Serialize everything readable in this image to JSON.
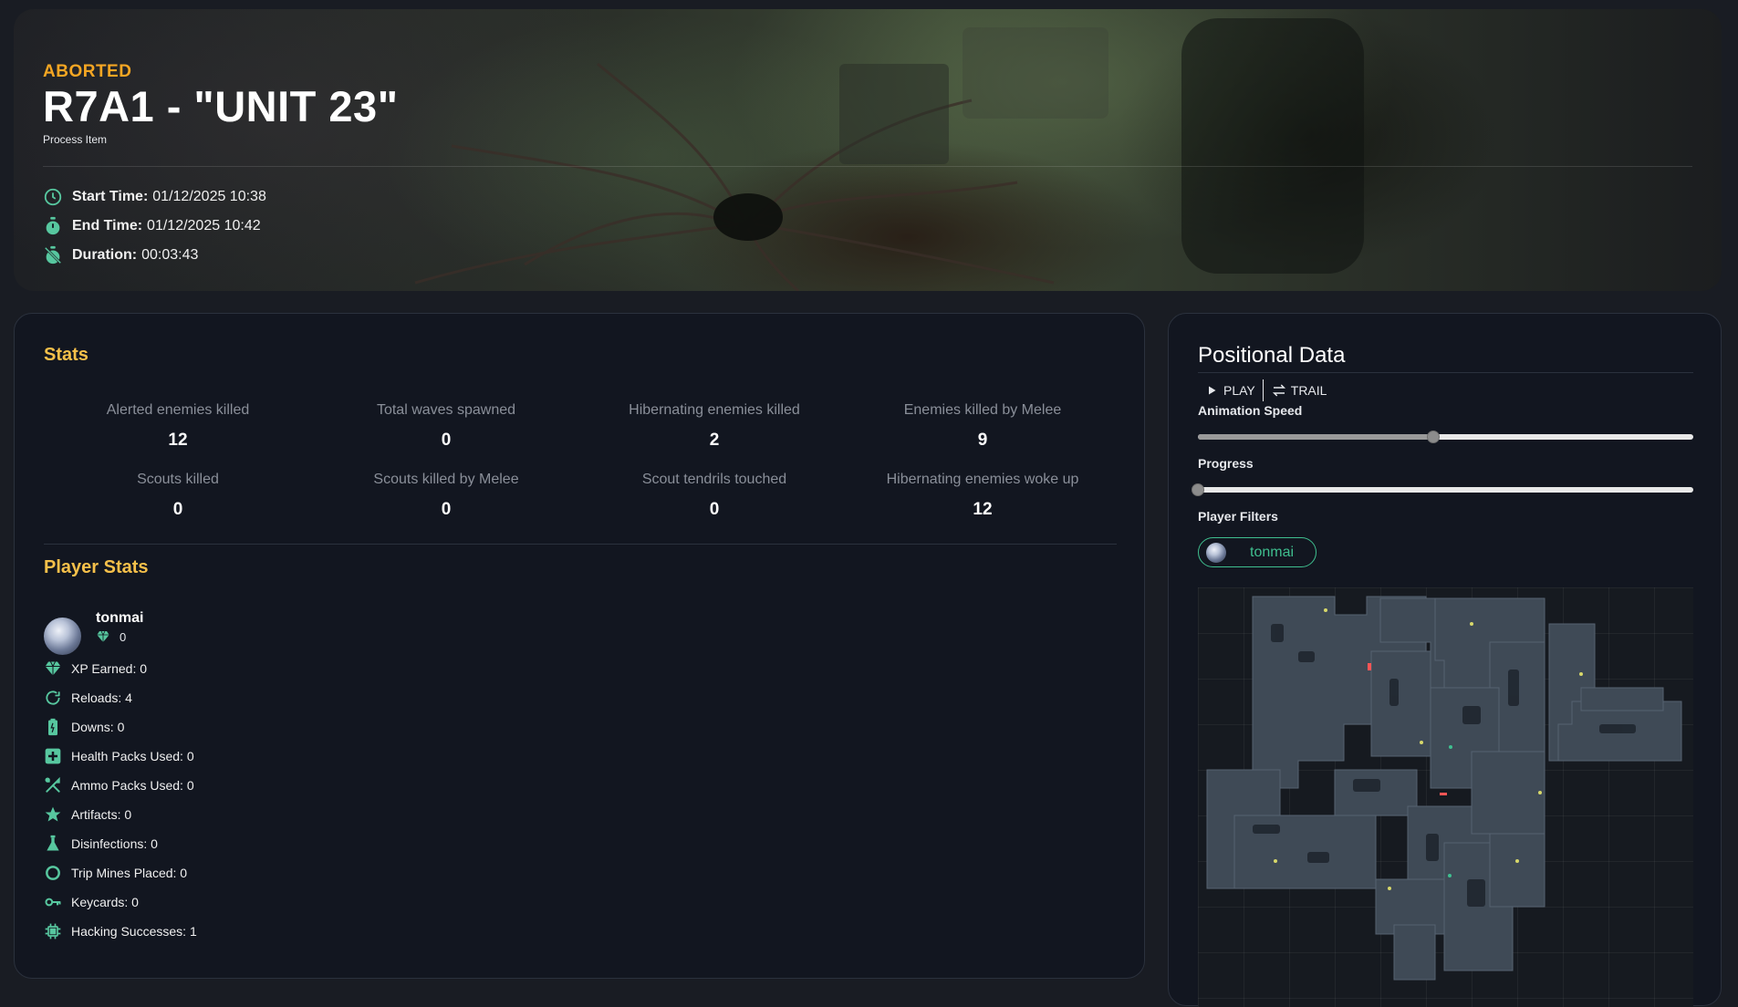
{
  "hero": {
    "status": "ABORTED",
    "title": "R7A1 - \"UNIT 23\"",
    "subtitle": "Process Item",
    "times": [
      {
        "icon": "clock-icon",
        "label": "Start Time:",
        "value": "01/12/2025 10:38"
      },
      {
        "icon": "stopwatch-icon",
        "label": "End Time:",
        "value": "01/12/2025 10:42"
      },
      {
        "icon": "timer-off-icon",
        "label": "Duration:",
        "value": "00:03:43"
      }
    ]
  },
  "stats": {
    "title": "Stats",
    "items": [
      {
        "label": "Alerted enemies killed",
        "value": "12"
      },
      {
        "label": "Total waves spawned",
        "value": "0"
      },
      {
        "label": "Hibernating enemies killed",
        "value": "2"
      },
      {
        "label": "Enemies killed by Melee",
        "value": "9"
      },
      {
        "label": "Scouts killed",
        "value": "0"
      },
      {
        "label": "Scouts killed by Melee",
        "value": "0"
      },
      {
        "label": "Scout tendrils touched",
        "value": "0"
      },
      {
        "label": "Hibernating enemies woke up",
        "value": "12"
      }
    ]
  },
  "player_stats": {
    "title": "Player Stats",
    "player": {
      "name": "tonmai",
      "level": "0"
    },
    "rows": [
      {
        "icon": "gem-icon",
        "text": "XP Earned: 0"
      },
      {
        "icon": "reload-icon",
        "text": "Reloads: 4"
      },
      {
        "icon": "battery-icon",
        "text": "Downs: 0"
      },
      {
        "icon": "medkit-icon",
        "text": "Health Packs Used: 0"
      },
      {
        "icon": "tools-icon",
        "text": "Ammo Packs Used: 0"
      },
      {
        "icon": "star-icon",
        "text": "Artifacts: 0"
      },
      {
        "icon": "flask-icon",
        "text": "Disinfections: 0"
      },
      {
        "icon": "ring-icon",
        "text": "Trip Mines Placed: 0"
      },
      {
        "icon": "key-icon",
        "text": "Keycards: 0"
      },
      {
        "icon": "chip-icon",
        "text": "Hacking Successes: 1"
      }
    ]
  },
  "positional": {
    "title": "Positional Data",
    "play_label": "PLAY",
    "trail_label": "TRAIL",
    "speed_label": "Animation Speed",
    "speed_value": 0.475,
    "progress_label": "Progress",
    "progress_value": 0,
    "filters_label": "Player Filters",
    "filter_player": "tonmai"
  },
  "colors": {
    "accent_orange": "#f5a623",
    "accent_yellow": "#f5c04a",
    "accent_green": "#3fbf8f",
    "panel_bg": "#121620",
    "page_bg": "#191c23"
  }
}
